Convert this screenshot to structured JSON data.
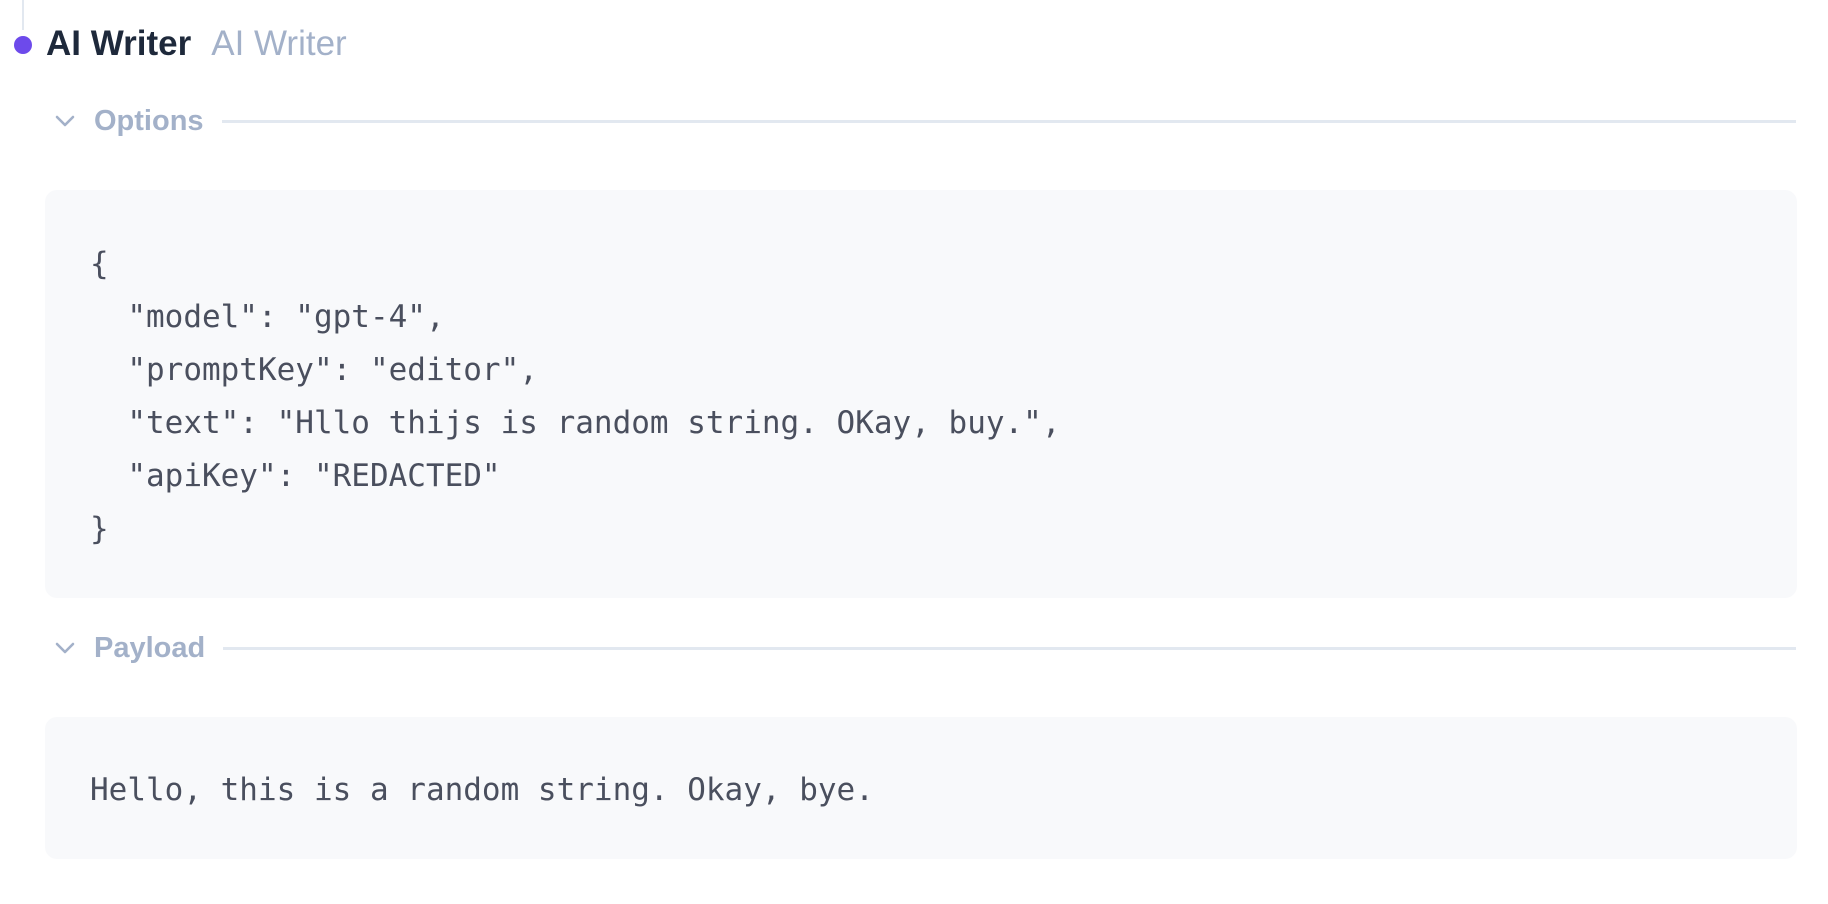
{
  "node": {
    "title": "AI Writer",
    "subtitle": "AI Writer",
    "accent_color": "#6d4aeb"
  },
  "options": {
    "label": "Options",
    "expanded": true,
    "icon": "chevron-down-icon",
    "lines": [
      "{",
      "  \"model\": \"gpt-4\",",
      "  \"promptKey\": \"editor\",",
      "  \"text\": \"Hllo thijs is random string. OKay, buy.\",",
      "  \"apiKey\": \"REDACTED\"",
      "}"
    ]
  },
  "payload": {
    "label": "Payload",
    "expanded": true,
    "icon": "chevron-down-icon",
    "text": "Hello, this is a random string. Okay, bye."
  }
}
